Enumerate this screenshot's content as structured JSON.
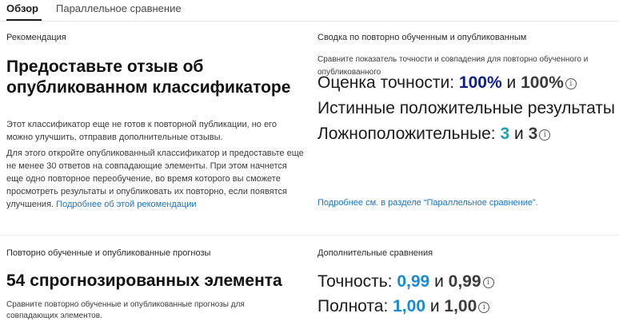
{
  "tabs": [
    {
      "label": "Обзор",
      "active": true
    },
    {
      "label": "Параллельное сравнение",
      "active": false
    }
  ],
  "recommendation": {
    "section_title": "Рекомендация",
    "headline": "Предоставьте отзыв об опубликованном классификаторе",
    "para1": "Этот классификатор еще не готов к повторной публикации, но его можно улучшить, отправив дополнительные отзывы.",
    "para2": "Для этого откройте опубликованный классификатор и предоставьте еще не менее 30 ответов на совпадающие элементы. При этом начнется еще одно повторное переобучение, во время которого вы сможете просмотреть результаты и опубликовать их повторно, если появятся улучшения.",
    "link": "Подробнее об этой рекомендации"
  },
  "summary": {
    "section_title": "Сводка по повторно обученным и опубликованным",
    "description": "Сравните показатель точности и совпадения для повторно обученного и опубликованного",
    "accuracy_label": "Оценка точности:",
    "accuracy_retrained": "100%",
    "accuracy_published": "100%",
    "conjunction": "и",
    "true_positive_label": "Истинные положительные результаты",
    "false_positive_label": "Ложноположительные:",
    "fp_retrained": "3",
    "fp_published": "3",
    "link": "Подробнее см. в разделе “Параллельное сравнение”."
  },
  "predictions": {
    "section_title": "Повторно обученные и опубликованные прогнозы",
    "headline": "54 спрогнозированных элемента",
    "description": "Сравните повторно обученные и опубликованные прогнозы для совпадающих элементов."
  },
  "comparisons": {
    "section_title": "Дополнительные сравнения",
    "precision_label": "Точность:",
    "precision_retrained": "0,99",
    "precision_published": "0,99",
    "recall_label": "Полнота:",
    "recall_retrained": "1,00",
    "recall_published": "1,00",
    "conjunction": "и"
  },
  "icons": {
    "info": "info-icon"
  },
  "colors": {
    "navy": "#0f1f8c",
    "teal": "#1aa3b5",
    "blue": "#1a8ad4",
    "link": "#1a73c8"
  }
}
